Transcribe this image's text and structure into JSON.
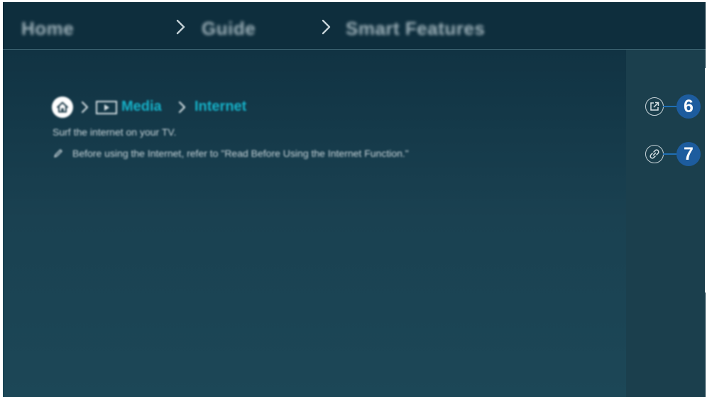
{
  "topbar": {
    "crumbs": [
      "Home",
      "Guide",
      "Smart Features"
    ]
  },
  "content": {
    "home_icon": "home-icon",
    "path": [
      "Media",
      "Internet"
    ],
    "description": "Surf the internet on your TV.",
    "note": "Before using the Internet, refer to \"Read Before Using the Internet Function.\""
  },
  "sidebar": {
    "icons": [
      "open-in-new-icon",
      "link-icon"
    ],
    "callouts": [
      "6",
      "7"
    ]
  },
  "colors": {
    "background": "#163b4b",
    "topbar": "#0e2e3d",
    "link_accent": "#16b1c8",
    "callout": "#1d5c9e"
  }
}
